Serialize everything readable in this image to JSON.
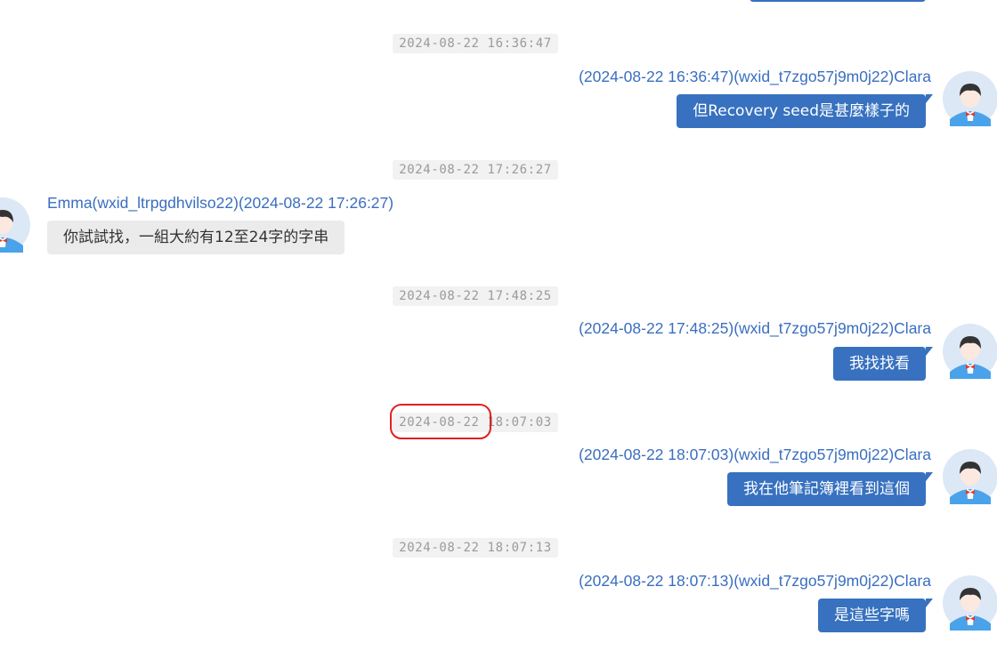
{
  "timestamps": [
    "2024-08-22 16:36:47",
    "2024-08-22 17:26:27",
    "2024-08-22 17:48:25",
    "2024-08-22 18:07:03",
    "2024-08-22 18:07:13"
  ],
  "messages": [
    {
      "direction": "outgoing",
      "meta": "(2024-08-22 16:36:47)(wxid_t7zgo57j9m0j22)Clara",
      "text": "但Recovery seed是甚麼樣子的"
    },
    {
      "direction": "incoming",
      "meta": "Emma(wxid_ltrpgdhvilso22)(2024-08-22 17:26:27)",
      "text": "你試試找，一組大約有12至24字的字串"
    },
    {
      "direction": "outgoing",
      "meta": "(2024-08-22 17:48:25)(wxid_t7zgo57j9m0j22)Clara",
      "text": "我找找看"
    },
    {
      "direction": "outgoing",
      "meta": "(2024-08-22 18:07:03)(wxid_t7zgo57j9m0j22)Clara",
      "text": "我在他筆記簿裡看到這個"
    },
    {
      "direction": "outgoing",
      "meta": "(2024-08-22 18:07:13)(wxid_t7zgo57j9m0j22)Clara",
      "text": "是這些字嗎"
    }
  ],
  "colors": {
    "outgoing_bubble": "#3771bf",
    "incoming_bubble": "#ebebeb",
    "meta_text": "#3a6ec0",
    "timestamp_bg": "#f2f2f2",
    "highlight": "#e02020"
  },
  "icons": {
    "avatar": "user-avatar-icon"
  }
}
